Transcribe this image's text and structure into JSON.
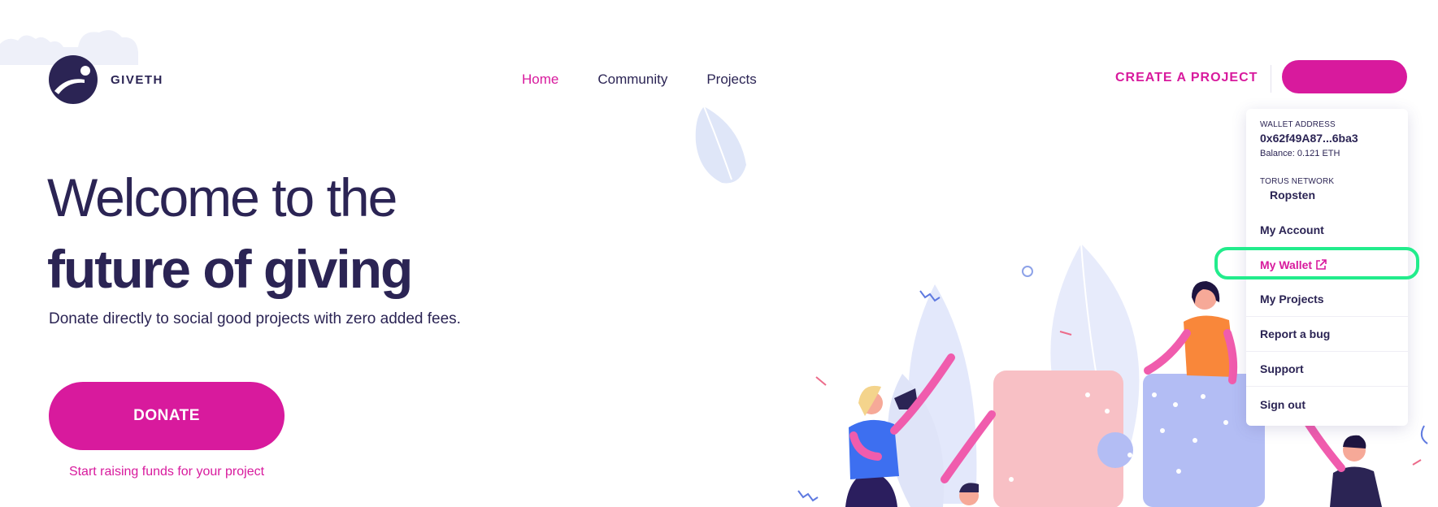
{
  "header": {
    "logo_text": "GIVETH",
    "nav": [
      {
        "label": "Home",
        "active": true
      },
      {
        "label": "Community",
        "active": false
      },
      {
        "label": "Projects",
        "active": false
      }
    ],
    "create_project_label": "CREATE A PROJECT"
  },
  "hero": {
    "title_line1": "Welcome to the",
    "title_line2": "future of giving",
    "subtitle": "Donate directly to social good projects with zero added fees.",
    "donate_label": "DONATE",
    "raise_link": "Start raising funds for your project"
  },
  "wallet_menu": {
    "wallet_address_label": "WALLET ADDRESS",
    "wallet_address": "0x62f49A87...6ba3",
    "balance": "Balance: 0.121 ETH",
    "network_label": "TORUS NETWORK",
    "network": "Ropsten",
    "items": [
      {
        "label": "My Account"
      },
      {
        "label": "My Wallet",
        "icon": "external-link-icon"
      },
      {
        "label": "My Projects"
      },
      {
        "label": "Report a bug"
      },
      {
        "label": "Support"
      },
      {
        "label": "Sign out"
      }
    ]
  },
  "colors": {
    "brand_pink": "#d81a9d",
    "navy": "#2b2454",
    "highlight_green": "#22ec8c",
    "lilac": "#dfe4f8"
  }
}
